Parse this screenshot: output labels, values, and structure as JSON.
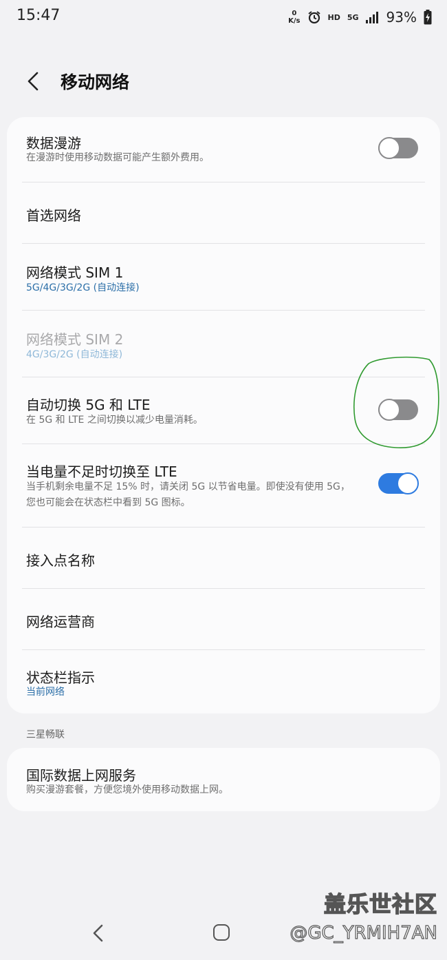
{
  "status_bar": {
    "time": "15:47",
    "net_speed_value": "0",
    "net_speed_unit": "K/s",
    "hd": "HD",
    "network_type": "5G",
    "battery": "93%",
    "icons": [
      "alarm-icon",
      "signal-icon",
      "battery-charging-icon"
    ]
  },
  "header": {
    "title": "移动网络",
    "back_icon": "back-chevron-icon"
  },
  "settings": {
    "data_roaming": {
      "title": "数据漫游",
      "subtitle": "在漫游时使用移动数据可能产生额外费用。",
      "enabled": false
    },
    "preferred_network": {
      "title": "首选网络"
    },
    "network_mode_sim1": {
      "title": "网络模式 SIM 1",
      "value": "5G/4G/3G/2G (自动连接)"
    },
    "network_mode_sim2": {
      "title": "网络模式 SIM 2",
      "value": "4G/3G/2G (自动连接)"
    },
    "auto_switch": {
      "title": "自动切换 5G 和 LTE",
      "subtitle": "在 5G 和 LTE 之间切换以减少电量消耗。",
      "enabled": false
    },
    "low_battery_lte": {
      "title": "当电量不足时切换至 LTE",
      "subtitle": "当手机剩余电量不足 15% 时，请关闭 5G 以节省电量。即使没有使用 5G，您也可能会在状态栏中看到 5G 图标。",
      "enabled": true
    },
    "apn": {
      "title": "接入点名称"
    },
    "carrier": {
      "title": "网络运营商"
    },
    "status_bar_indicator": {
      "title": "状态栏指示",
      "value": "当前网络"
    }
  },
  "samsung_section": {
    "label": "三星畅联",
    "intl_data": {
      "title": "国际数据上网服务",
      "subtitle": "购买漫游套餐，方便您境外使用移动数据上网。"
    }
  },
  "watermark": {
    "site": "盖乐世社区",
    "user": "@GC_YRMIH7AN"
  },
  "colors": {
    "accent": "#2e7be0",
    "link": "#2c6fa8",
    "annotation": "#2f9a2f"
  }
}
